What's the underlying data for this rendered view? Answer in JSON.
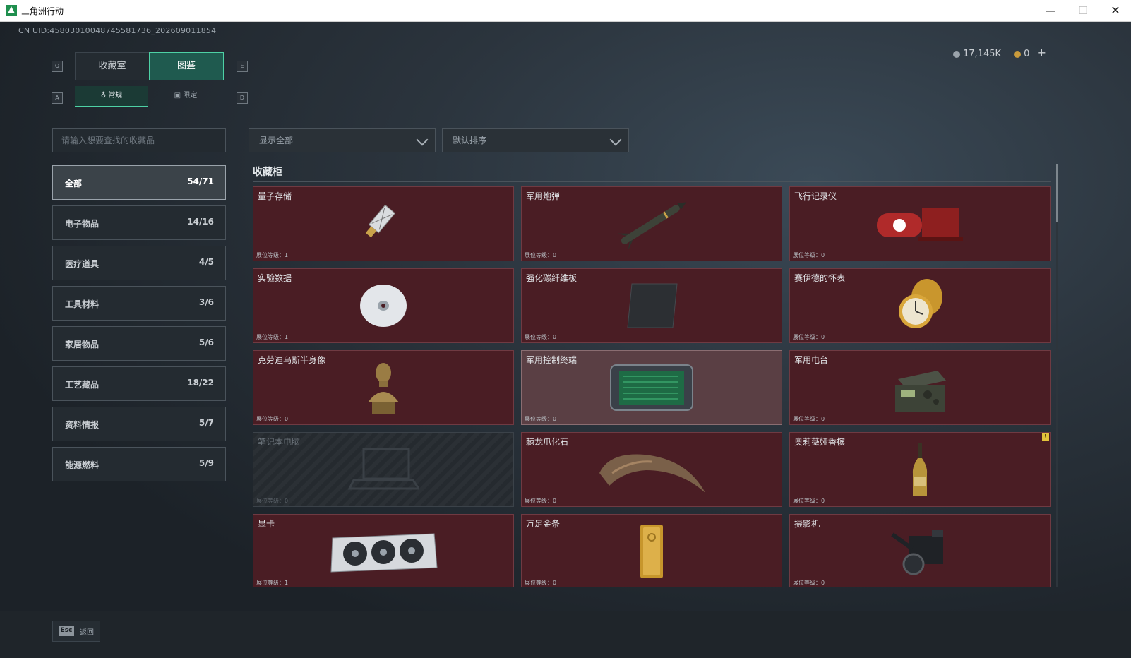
{
  "window": {
    "title": "三角洲行动",
    "min": "—",
    "max": "☐",
    "close": "✕"
  },
  "uid": "CN UID:4580301004874558173​6_20260901185​4",
  "currency": {
    "silver": "17,145K",
    "gold": "0",
    "plus": "+"
  },
  "keys": {
    "q": "Q",
    "e": "E",
    "a": "A",
    "d": "D",
    "esc": "Esc"
  },
  "tabs": [
    {
      "label": "收藏室"
    },
    {
      "label": "图鉴"
    }
  ],
  "subtabs": [
    {
      "label": "常规",
      "icon": "bottle-icon"
    },
    {
      "label": "限定",
      "icon": "image-icon"
    }
  ],
  "search": {
    "placeholder": "请输入想要查找的收藏品"
  },
  "filters": {
    "show": "显示全部",
    "sort": "默认排序"
  },
  "categories": [
    {
      "label": "全部",
      "count": "54/71"
    },
    {
      "label": "电子物品",
      "count": "14/16"
    },
    {
      "label": "医疗道具",
      "count": "4/5"
    },
    {
      "label": "工具材料",
      "count": "3/6"
    },
    {
      "label": "家居物品",
      "count": "5/6"
    },
    {
      "label": "工艺藏品",
      "count": "18/22"
    },
    {
      "label": "资料情报",
      "count": "5/7"
    },
    {
      "label": "能源燃料",
      "count": "5/9"
    }
  ],
  "section_title": "收藏柜",
  "items": [
    {
      "name": "量子存储",
      "level": "展位等级：1",
      "icon": "usb-drive-icon"
    },
    {
      "name": "军用炮弹",
      "level": "展位等级：0",
      "icon": "missile-icon"
    },
    {
      "name": "飞行记录仪",
      "level": "展位等级：0",
      "icon": "flight-recorder-icon"
    },
    {
      "name": "实验数据",
      "level": "展位等级：1",
      "icon": "disc-icon"
    },
    {
      "name": "强化碳纤维板",
      "level": "展位等级：0",
      "icon": "carbon-plate-icon"
    },
    {
      "name": "赛伊德的怀表",
      "level": "展位等级：0",
      "icon": "pocket-watch-icon"
    },
    {
      "name": "克劳迪乌斯半身像",
      "level": "展位等级：0",
      "icon": "bust-icon"
    },
    {
      "name": "军用控制终端",
      "level": "展位等级：0",
      "icon": "terminal-icon"
    },
    {
      "name": "军用电台",
      "level": "展位等级：0",
      "icon": "radio-icon"
    },
    {
      "name": "笔记本电脑",
      "level": "展位等级：0",
      "icon": "laptop-icon"
    },
    {
      "name": "棘龙爪化石",
      "level": "展位等级：0",
      "icon": "claw-fossil-icon"
    },
    {
      "name": "奥莉薇娅香槟",
      "level": "展位等级：0",
      "icon": "champagne-icon"
    },
    {
      "name": "显卡",
      "level": "展位等级：1",
      "icon": "gpu-icon"
    },
    {
      "name": "万足金条",
      "level": "展位等级：0",
      "icon": "gold-bar-icon"
    },
    {
      "name": "摄影机",
      "level": "展位等级：0",
      "icon": "camera-icon"
    }
  ],
  "badge": "!",
  "bottom": {
    "back": "返回"
  },
  "colors": {
    "accent": "#4ed1a5",
    "card": "#4a1d24",
    "card_highlight": "#5a3f44",
    "badge": "#e3c33b"
  }
}
